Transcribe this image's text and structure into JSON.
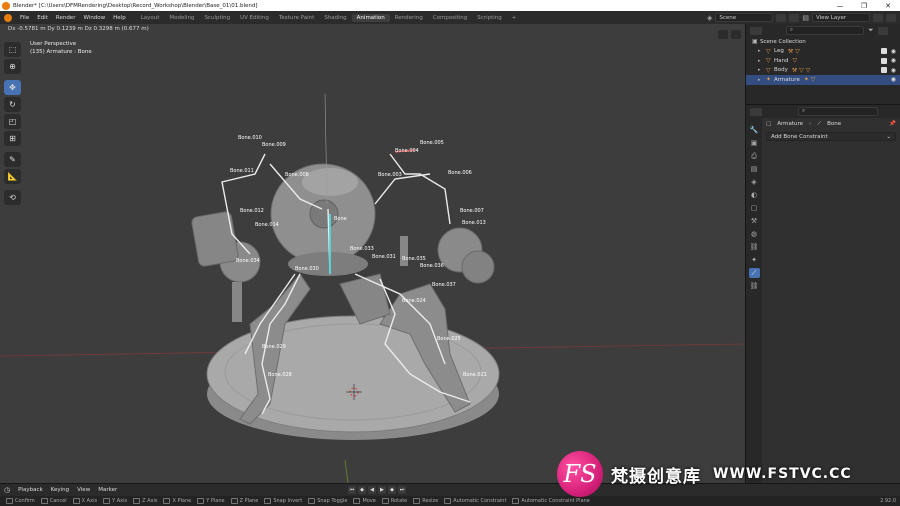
{
  "window": {
    "title": "Blender* [C:\\Users\\DFMRendering\\Desktop\\Record_Workshop\\Blender\\Base_01\\01.blend]",
    "controls": [
      "—",
      "❐",
      "✕"
    ]
  },
  "menu": [
    "File",
    "Edit",
    "Render",
    "Window",
    "Help"
  ],
  "workspaces": [
    "Layout",
    "Modeling",
    "Sculpting",
    "UV Editing",
    "Texture Paint",
    "Shading",
    "Animation",
    "Rendering",
    "Compositing",
    "Scripting",
    "+"
  ],
  "active_workspace": "Animation",
  "scene": {
    "label": "Scene",
    "view_layer": "View Layer"
  },
  "viewport": {
    "delta": "Dx -0.5781 m  Dy 0.1239 m  Dz 0.3298 m (0.677 m)",
    "perspective": "User Perspective",
    "object": "(135) Armature : Bone"
  },
  "bone_labels": [
    "Bone.009",
    "Bone.010",
    "Bone.005",
    "Bone.004",
    "Bone.011",
    "Bone.008",
    "Bone.003",
    "Bone.006",
    "Bone",
    "Bone.012",
    "Bone.007",
    "Bone.014",
    "Bone.013",
    "Bone.035",
    "Bone.036",
    "Bone.037",
    "Bone.030",
    "Bone.034",
    "Bone.029",
    "Bone.028",
    "Bone.025",
    "Bone.021",
    "Bone.033",
    "Bone.031",
    "Bone.024"
  ],
  "outliner": {
    "collection": "Scene Collection",
    "items": [
      {
        "name": "Leg",
        "selected": false
      },
      {
        "name": "Hand",
        "selected": false
      },
      {
        "name": "Body",
        "selected": false
      },
      {
        "name": "Armature",
        "selected": true
      }
    ]
  },
  "properties": {
    "breadcrumb_object": "Armature",
    "breadcrumb_bone": "Bone",
    "add_constraint": "Add Bone Constraint"
  },
  "timeline": {
    "menus": [
      "Playback",
      "Keying",
      "View",
      "Marker"
    ]
  },
  "statusbar": {
    "items": [
      "Confirm",
      "Cancel",
      "X Axis",
      "Y Axis",
      "Z Axis",
      "X Plane",
      "Y Plane",
      "Z Plane",
      "Snap Invert",
      "Snap Toggle",
      "Move",
      "Rotate",
      "Resize",
      "Automatic Constraint",
      "Automatic Constraint Plane"
    ],
    "version": "2.92.0"
  },
  "watermark": {
    "badge": "FS",
    "cn": "梵摄创意库",
    "url": "WWW.FSTVC.CC"
  },
  "colors": {
    "accent": "#4772b3",
    "selected_row": "#334d80",
    "brand_orange": "#e87d0d",
    "watermark_pink": "#d7217a"
  }
}
